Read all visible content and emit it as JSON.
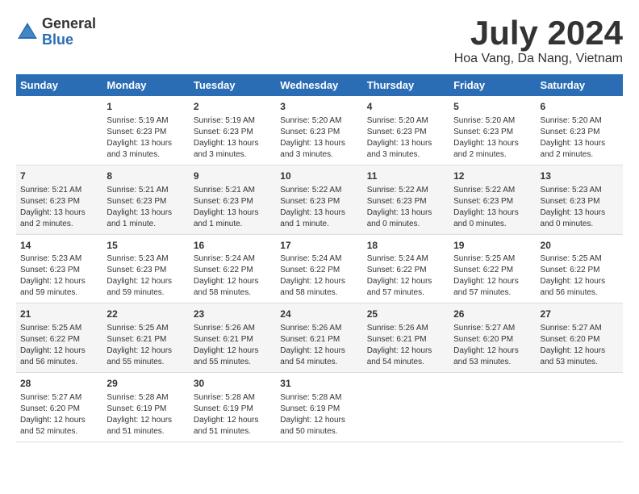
{
  "header": {
    "logo_general": "General",
    "logo_blue": "Blue",
    "month_title": "July 2024",
    "location": "Hoa Vang, Da Nang, Vietnam"
  },
  "calendar": {
    "days_of_week": [
      "Sunday",
      "Monday",
      "Tuesday",
      "Wednesday",
      "Thursday",
      "Friday",
      "Saturday"
    ],
    "weeks": [
      [
        {
          "num": "",
          "info": ""
        },
        {
          "num": "1",
          "info": "Sunrise: 5:19 AM\nSunset: 6:23 PM\nDaylight: 13 hours\nand 3 minutes."
        },
        {
          "num": "2",
          "info": "Sunrise: 5:19 AM\nSunset: 6:23 PM\nDaylight: 13 hours\nand 3 minutes."
        },
        {
          "num": "3",
          "info": "Sunrise: 5:20 AM\nSunset: 6:23 PM\nDaylight: 13 hours\nand 3 minutes."
        },
        {
          "num": "4",
          "info": "Sunrise: 5:20 AM\nSunset: 6:23 PM\nDaylight: 13 hours\nand 3 minutes."
        },
        {
          "num": "5",
          "info": "Sunrise: 5:20 AM\nSunset: 6:23 PM\nDaylight: 13 hours\nand 2 minutes."
        },
        {
          "num": "6",
          "info": "Sunrise: 5:20 AM\nSunset: 6:23 PM\nDaylight: 13 hours\nand 2 minutes."
        }
      ],
      [
        {
          "num": "7",
          "info": "Sunrise: 5:21 AM\nSunset: 6:23 PM\nDaylight: 13 hours\nand 2 minutes."
        },
        {
          "num": "8",
          "info": "Sunrise: 5:21 AM\nSunset: 6:23 PM\nDaylight: 13 hours\nand 1 minute."
        },
        {
          "num": "9",
          "info": "Sunrise: 5:21 AM\nSunset: 6:23 PM\nDaylight: 13 hours\nand 1 minute."
        },
        {
          "num": "10",
          "info": "Sunrise: 5:22 AM\nSunset: 6:23 PM\nDaylight: 13 hours\nand 1 minute."
        },
        {
          "num": "11",
          "info": "Sunrise: 5:22 AM\nSunset: 6:23 PM\nDaylight: 13 hours\nand 0 minutes."
        },
        {
          "num": "12",
          "info": "Sunrise: 5:22 AM\nSunset: 6:23 PM\nDaylight: 13 hours\nand 0 minutes."
        },
        {
          "num": "13",
          "info": "Sunrise: 5:23 AM\nSunset: 6:23 PM\nDaylight: 13 hours\nand 0 minutes."
        }
      ],
      [
        {
          "num": "14",
          "info": "Sunrise: 5:23 AM\nSunset: 6:23 PM\nDaylight: 12 hours\nand 59 minutes."
        },
        {
          "num": "15",
          "info": "Sunrise: 5:23 AM\nSunset: 6:23 PM\nDaylight: 12 hours\nand 59 minutes."
        },
        {
          "num": "16",
          "info": "Sunrise: 5:24 AM\nSunset: 6:22 PM\nDaylight: 12 hours\nand 58 minutes."
        },
        {
          "num": "17",
          "info": "Sunrise: 5:24 AM\nSunset: 6:22 PM\nDaylight: 12 hours\nand 58 minutes."
        },
        {
          "num": "18",
          "info": "Sunrise: 5:24 AM\nSunset: 6:22 PM\nDaylight: 12 hours\nand 57 minutes."
        },
        {
          "num": "19",
          "info": "Sunrise: 5:25 AM\nSunset: 6:22 PM\nDaylight: 12 hours\nand 57 minutes."
        },
        {
          "num": "20",
          "info": "Sunrise: 5:25 AM\nSunset: 6:22 PM\nDaylight: 12 hours\nand 56 minutes."
        }
      ],
      [
        {
          "num": "21",
          "info": "Sunrise: 5:25 AM\nSunset: 6:22 PM\nDaylight: 12 hours\nand 56 minutes."
        },
        {
          "num": "22",
          "info": "Sunrise: 5:25 AM\nSunset: 6:21 PM\nDaylight: 12 hours\nand 55 minutes."
        },
        {
          "num": "23",
          "info": "Sunrise: 5:26 AM\nSunset: 6:21 PM\nDaylight: 12 hours\nand 55 minutes."
        },
        {
          "num": "24",
          "info": "Sunrise: 5:26 AM\nSunset: 6:21 PM\nDaylight: 12 hours\nand 54 minutes."
        },
        {
          "num": "25",
          "info": "Sunrise: 5:26 AM\nSunset: 6:21 PM\nDaylight: 12 hours\nand 54 minutes."
        },
        {
          "num": "26",
          "info": "Sunrise: 5:27 AM\nSunset: 6:20 PM\nDaylight: 12 hours\nand 53 minutes."
        },
        {
          "num": "27",
          "info": "Sunrise: 5:27 AM\nSunset: 6:20 PM\nDaylight: 12 hours\nand 53 minutes."
        }
      ],
      [
        {
          "num": "28",
          "info": "Sunrise: 5:27 AM\nSunset: 6:20 PM\nDaylight: 12 hours\nand 52 minutes."
        },
        {
          "num": "29",
          "info": "Sunrise: 5:28 AM\nSunset: 6:19 PM\nDaylight: 12 hours\nand 51 minutes."
        },
        {
          "num": "30",
          "info": "Sunrise: 5:28 AM\nSunset: 6:19 PM\nDaylight: 12 hours\nand 51 minutes."
        },
        {
          "num": "31",
          "info": "Sunrise: 5:28 AM\nSunset: 6:19 PM\nDaylight: 12 hours\nand 50 minutes."
        },
        {
          "num": "",
          "info": ""
        },
        {
          "num": "",
          "info": ""
        },
        {
          "num": "",
          "info": ""
        }
      ]
    ]
  }
}
